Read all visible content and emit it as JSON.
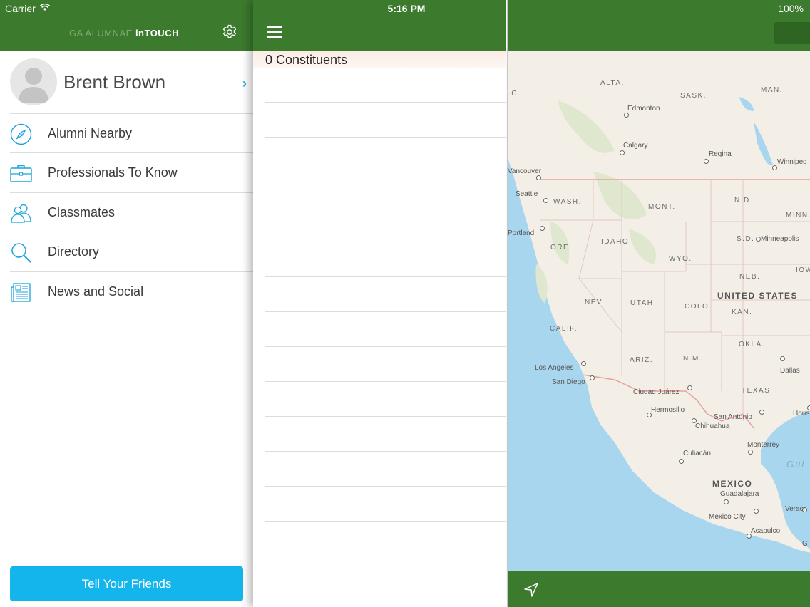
{
  "status_bar": {
    "carrier": "Carrier",
    "time": "5:16 PM",
    "battery": "100%"
  },
  "menu": {
    "title_light": "GA ALUMNAE",
    "title_bold": "inTOUCH",
    "profile_name": "Brent Brown",
    "profile_chevron": "›",
    "items": [
      {
        "label": "Alumni Nearby",
        "icon": "compass-icon"
      },
      {
        "label": "Professionals To Know",
        "icon": "briefcase-icon"
      },
      {
        "label": "Classmates",
        "icon": "people-icon"
      },
      {
        "label": "Directory",
        "icon": "search-icon"
      },
      {
        "label": "News and Social",
        "icon": "newspaper-icon"
      }
    ],
    "tell_friends_label": "Tell Your Friends"
  },
  "list": {
    "count_label": "0 Constituents"
  },
  "map": {
    "regions": [
      "ALTA.",
      "SASK.",
      "MAN.",
      "WASH.",
      "MONT.",
      "N.D.",
      "MINN.",
      "ORE.",
      "IDAHO",
      "S.D.",
      "WYO.",
      "NEB.",
      "IOW",
      "NEV.",
      "UTAH",
      "COLO.",
      "KAN.",
      "CALIF.",
      "ARIZ.",
      "N.M.",
      "OKLA.",
      "TEXAS",
      ".C."
    ],
    "country_labels": [
      "UNITED STATES",
      "MEXICO"
    ],
    "water_labels": [
      "Gul"
    ],
    "cities": [
      "Edmonton",
      "Calgary",
      "Regina",
      "Winnipeg",
      "Vancouver",
      "Seattle",
      "Portland",
      "Minneapolis",
      "Los Angeles",
      "San Diego",
      "Ciudad Juárez",
      "Dallas",
      "Hermosillo",
      "San Antonio",
      "Chihuahua",
      "Hous",
      "Monterrey",
      "Culiacán",
      "Guadalajara",
      "Mexico City",
      "Veracr",
      "Acapulco",
      "G"
    ]
  },
  "colors": {
    "header_green": "#3c7a2d",
    "accent_blue": "#14b4ec",
    "icon_blue": "#1aa3dc"
  }
}
